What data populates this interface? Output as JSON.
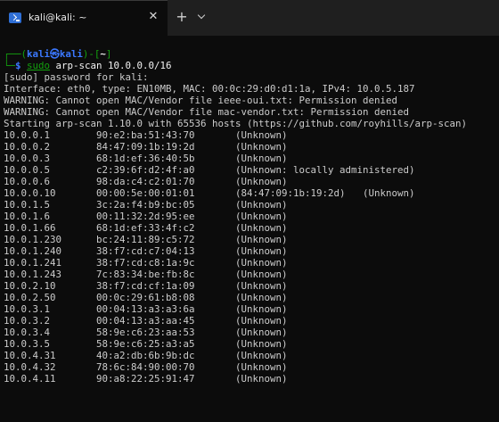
{
  "tab": {
    "title": "kali@kali: ~",
    "close_icon": "close-icon",
    "new_tab_icon": "plus-icon",
    "dropdown_icon": "chevron-down-icon"
  },
  "prompt": {
    "box_start": "┌──(",
    "user": "kali",
    "at": "㉿",
    "host": "kali",
    "mid": ")-[",
    "path": "~",
    "end": "]",
    "box_end": "└─",
    "dollar": "$ ",
    "cmd_sudo": "sudo",
    "cmd_rest": " arp-scan 10.0.0.0/16"
  },
  "output": [
    "[sudo] password for kali:",
    "Interface: eth0, type: EN10MB, MAC: 00:0c:29:d0:d1:1a, IPv4: 10.0.5.187",
    "WARNING: Cannot open MAC/Vendor file ieee-oui.txt: Permission denied",
    "WARNING: Cannot open MAC/Vendor file mac-vendor.txt: Permission denied",
    "Starting arp-scan 1.10.0 with 65536 hosts (https://github.com/royhills/arp-scan)"
  ],
  "hosts": [
    {
      "ip": "10.0.0.1",
      "mac": "90:e2:ba:51:43:70",
      "vendor": "(Unknown)"
    },
    {
      "ip": "10.0.0.2",
      "mac": "84:47:09:1b:19:2d",
      "vendor": "(Unknown)"
    },
    {
      "ip": "10.0.0.3",
      "mac": "68:1d:ef:36:40:5b",
      "vendor": "(Unknown)"
    },
    {
      "ip": "10.0.0.5",
      "mac": "c2:39:6f:d2:4f:a0",
      "vendor": "(Unknown: locally administered)"
    },
    {
      "ip": "10.0.0.6",
      "mac": "98:da:c4:c2:01:70",
      "vendor": "(Unknown)"
    },
    {
      "ip": "10.0.0.10",
      "mac": "00:00:5e:00:01:01",
      "vendor": "(84:47:09:1b:19:2d)   (Unknown)"
    },
    {
      "ip": "10.0.1.5",
      "mac": "3c:2a:f4:b9:bc:05",
      "vendor": "(Unknown)"
    },
    {
      "ip": "10.0.1.6",
      "mac": "00:11:32:2d:95:ee",
      "vendor": "(Unknown)"
    },
    {
      "ip": "10.0.1.66",
      "mac": "68:1d:ef:33:4f:c2",
      "vendor": "(Unknown)"
    },
    {
      "ip": "10.0.1.230",
      "mac": "bc:24:11:89:c5:72",
      "vendor": "(Unknown)"
    },
    {
      "ip": "10.0.1.240",
      "mac": "38:f7:cd:c7:04:13",
      "vendor": "(Unknown)"
    },
    {
      "ip": "10.0.1.241",
      "mac": "38:f7:cd:c8:1a:9c",
      "vendor": "(Unknown)"
    },
    {
      "ip": "10.0.1.243",
      "mac": "7c:83:34:be:fb:8c",
      "vendor": "(Unknown)"
    },
    {
      "ip": "10.0.2.10",
      "mac": "38:f7:cd:cf:1a:09",
      "vendor": "(Unknown)"
    },
    {
      "ip": "10.0.2.50",
      "mac": "00:0c:29:61:b8:08",
      "vendor": "(Unknown)"
    },
    {
      "ip": "10.0.3.1",
      "mac": "00:04:13:a3:a3:6a",
      "vendor": "(Unknown)"
    },
    {
      "ip": "10.0.3.2",
      "mac": "00:04:13:a3:aa:45",
      "vendor": "(Unknown)"
    },
    {
      "ip": "10.0.3.4",
      "mac": "58:9e:c6:23:aa:53",
      "vendor": "(Unknown)"
    },
    {
      "ip": "10.0.3.5",
      "mac": "58:9e:c6:25:a3:a5",
      "vendor": "(Unknown)"
    },
    {
      "ip": "10.0.4.31",
      "mac": "40:a2:db:6b:9b:dc",
      "vendor": "(Unknown)"
    },
    {
      "ip": "10.0.4.32",
      "mac": "78:6c:84:90:00:70",
      "vendor": "(Unknown)"
    },
    {
      "ip": "10.0.4.11",
      "mac": "90:a8:22:25:91:47",
      "vendor": "(Unknown)"
    }
  ],
  "colors": {
    "terminal_bg": "#0c0c0c",
    "prompt_green": "#13a10e",
    "prompt_blue": "#3b78ff",
    "text": "#cccccc"
  }
}
